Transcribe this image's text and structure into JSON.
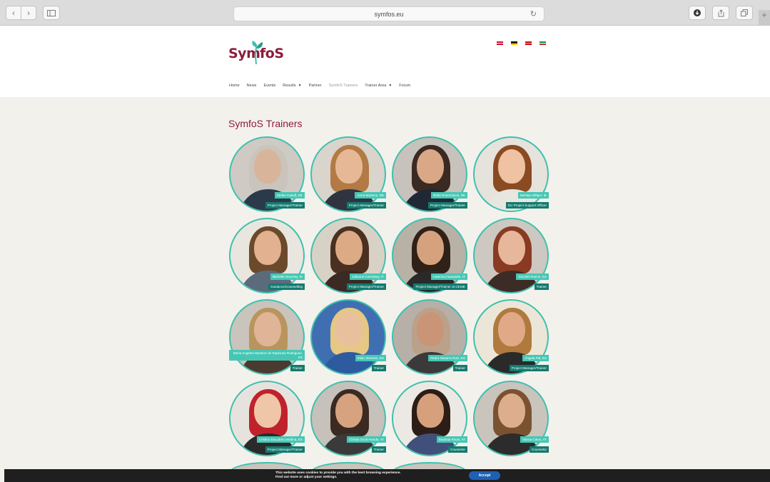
{
  "browser": {
    "url": "symfos.eu",
    "back_icon": "chevron-left-icon",
    "forward_icon": "chevron-right-icon",
    "reload_glyph": "↻"
  },
  "site": {
    "logo_parts": [
      "Sym",
      "foS"
    ],
    "menu": [
      {
        "label": "Home"
      },
      {
        "label": "News"
      },
      {
        "label": "Events"
      },
      {
        "label": "Results",
        "dropdown": true
      },
      {
        "label": "Partner"
      },
      {
        "label": "SymfoS Trainers",
        "active": true
      },
      {
        "label": "Trainer Area",
        "dropdown": true
      },
      {
        "label": "Forum"
      }
    ],
    "languages": [
      {
        "code": "en",
        "colors": [
          "#c8102e",
          "#ffffff",
          "#c8102e"
        ]
      },
      {
        "code": "de",
        "colors": [
          "#000000",
          "#dd0000",
          "#ffce00"
        ]
      },
      {
        "code": "es",
        "colors": [
          "#c60b1e",
          "#ffc400",
          "#c60b1e"
        ]
      },
      {
        "code": "it",
        "colors": [
          "#009246",
          "#ffffff",
          "#ce2b37"
        ]
      }
    ]
  },
  "page": {
    "title": "SymfoS Trainers"
  },
  "trainers": [
    {
      "name": "Stefan Kaindl, DE",
      "role": "Project Manager/Trainer",
      "skin": "#d8b49a",
      "hair": "#c9c4bc",
      "bg": "#cfcac4",
      "top": "#2b3a4a"
    },
    {
      "name": "Anna Martens, DE",
      "role": "Project Manager/Trainer",
      "skin": "#e7b896",
      "hair": "#b27a44",
      "bg": "#d9d4cc",
      "top": "#2f3440"
    },
    {
      "name": "Britta Rosenstock, DE",
      "role": "Project Manager/Trainer",
      "skin": "#d9a886",
      "hair": "#3a2a22",
      "bg": "#c7c2bb",
      "top": "#202836"
    },
    {
      "name": "Mehtap Kilfiger, IE",
      "role": "EU Project Support Officer",
      "skin": "#eec2a2",
      "hair": "#8a4a22",
      "bg": "#e6e2dc",
      "top": "#e8e6e0"
    },
    {
      "name": "Michelle Gourney, IE",
      "role": "Guidance/Counselling",
      "skin": "#e2b190",
      "hair": "#6b4a2c",
      "bg": "#e9e6df",
      "top": "#5b6b7c"
    },
    {
      "name": "Julianne Comiskey, IT",
      "role": "Project Manager/Trainer",
      "skin": "#ddaa86",
      "hair": "#4a3020",
      "bg": "#d8d2c6",
      "top": "#3b2a24"
    },
    {
      "name": "Caterina Impastato, IT",
      "role": "Project Manager/Trainer at CESIE",
      "skin": "#d6a27e",
      "hair": "#2f2018",
      "bg": "#b8b1a6",
      "top": "#2a2a2a"
    },
    {
      "name": "Dorothé Ramin, ES",
      "role": "Trainer",
      "skin": "#e6b79a",
      "hair": "#8a3a22",
      "bg": "#cdc8c1",
      "top": "#3d2c26"
    },
    {
      "name": "Maria Angeles Montero de Espinosa Rodriguez, ES",
      "role": "Trainer",
      "skin": "#e0b496",
      "hair": "#b9955e",
      "bg": "#c9c4bc",
      "top": "#4b3a30"
    },
    {
      "name": "Elian Jiménez, ES",
      "role": "Trainer",
      "skin": "#e9c09e",
      "hair": "#e6c784",
      "bg": "#3f6fb0",
      "top": "#2e5aa0"
    },
    {
      "name": "Pedro Navarro Ruiz, ES",
      "role": "Trainer",
      "skin": "#c99576",
      "hair": "#bba18a",
      "bg": "#b6b0a8",
      "top": "#3a3a3a"
    },
    {
      "name": "Angela Pitt, ES",
      "role": "Project Manager/Trainer",
      "skin": "#e0aa88",
      "hair": "#b07a3e",
      "bg": "#ece6d8",
      "top": "#2a2a2a"
    },
    {
      "name": "Cristina Escudero Medina, ES",
      "role": "Project Manager/Trainer",
      "skin": "#f0c6a8",
      "hair": "#c0222c",
      "bg": "#e6e3de",
      "top": "#2a2a2a"
    },
    {
      "name": "Christa Scott-Hands, AT",
      "role": "Trainer",
      "skin": "#d6a280",
      "hair": "#3b2a22",
      "bg": "#c6c1ba",
      "top": "#3a3a3a"
    },
    {
      "name": "Bautista Rivas, AT",
      "role": "Counselor",
      "skin": "#d6a07c",
      "hair": "#2c1e16",
      "bg": "#ece9e4",
      "top": "#40507a"
    },
    {
      "name": "Vanna Calvo, AT",
      "role": "Counselor",
      "skin": "#dcae8c",
      "hair": "#7a5230",
      "bg": "#c9c4bc",
      "top": "#2c2c2c"
    }
  ],
  "cookie_bar": {
    "line1": "This website uses cookies to provide you with the best browsing experience.",
    "line2": "Find out more or adjust your settings.",
    "accept_label": "Accept"
  }
}
